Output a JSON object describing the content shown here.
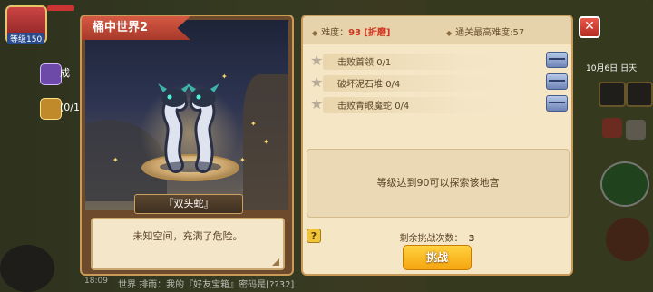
{
  "hud": {
    "level": "等级150",
    "left_text_1": "成",
    "left_text_2": "(0/1",
    "date": "10月6日",
    "weekday": "日天",
    "chat_prefix": "世界",
    "chat_text": "排雨：我的『好友宝箱』密码是[??32]",
    "time": "18:09"
  },
  "stage": {
    "title": "桶中世界2",
    "boss_name": "『双头蛇』",
    "description": "未知空间，充满了危险。"
  },
  "header": {
    "difficulty_label": "难度：",
    "difficulty_value": "93",
    "difficulty_tag": "[折磨]",
    "best_clear_label": "通关最高难度:",
    "best_clear_value": "57"
  },
  "tasks": [
    {
      "label": "击败首领",
      "progress": "0/1"
    },
    {
      "label": "破坏泥石堆",
      "progress": "0/4"
    },
    {
      "label": "击败青眼魔蛇",
      "progress": "0/4"
    }
  ],
  "requirement_text": "等级达到90可以探索该地宫",
  "remaining_label": "剩余挑战次数：",
  "remaining_count": "3",
  "challenge_label": "挑战",
  "help_label": "?",
  "close_label": "✕"
}
